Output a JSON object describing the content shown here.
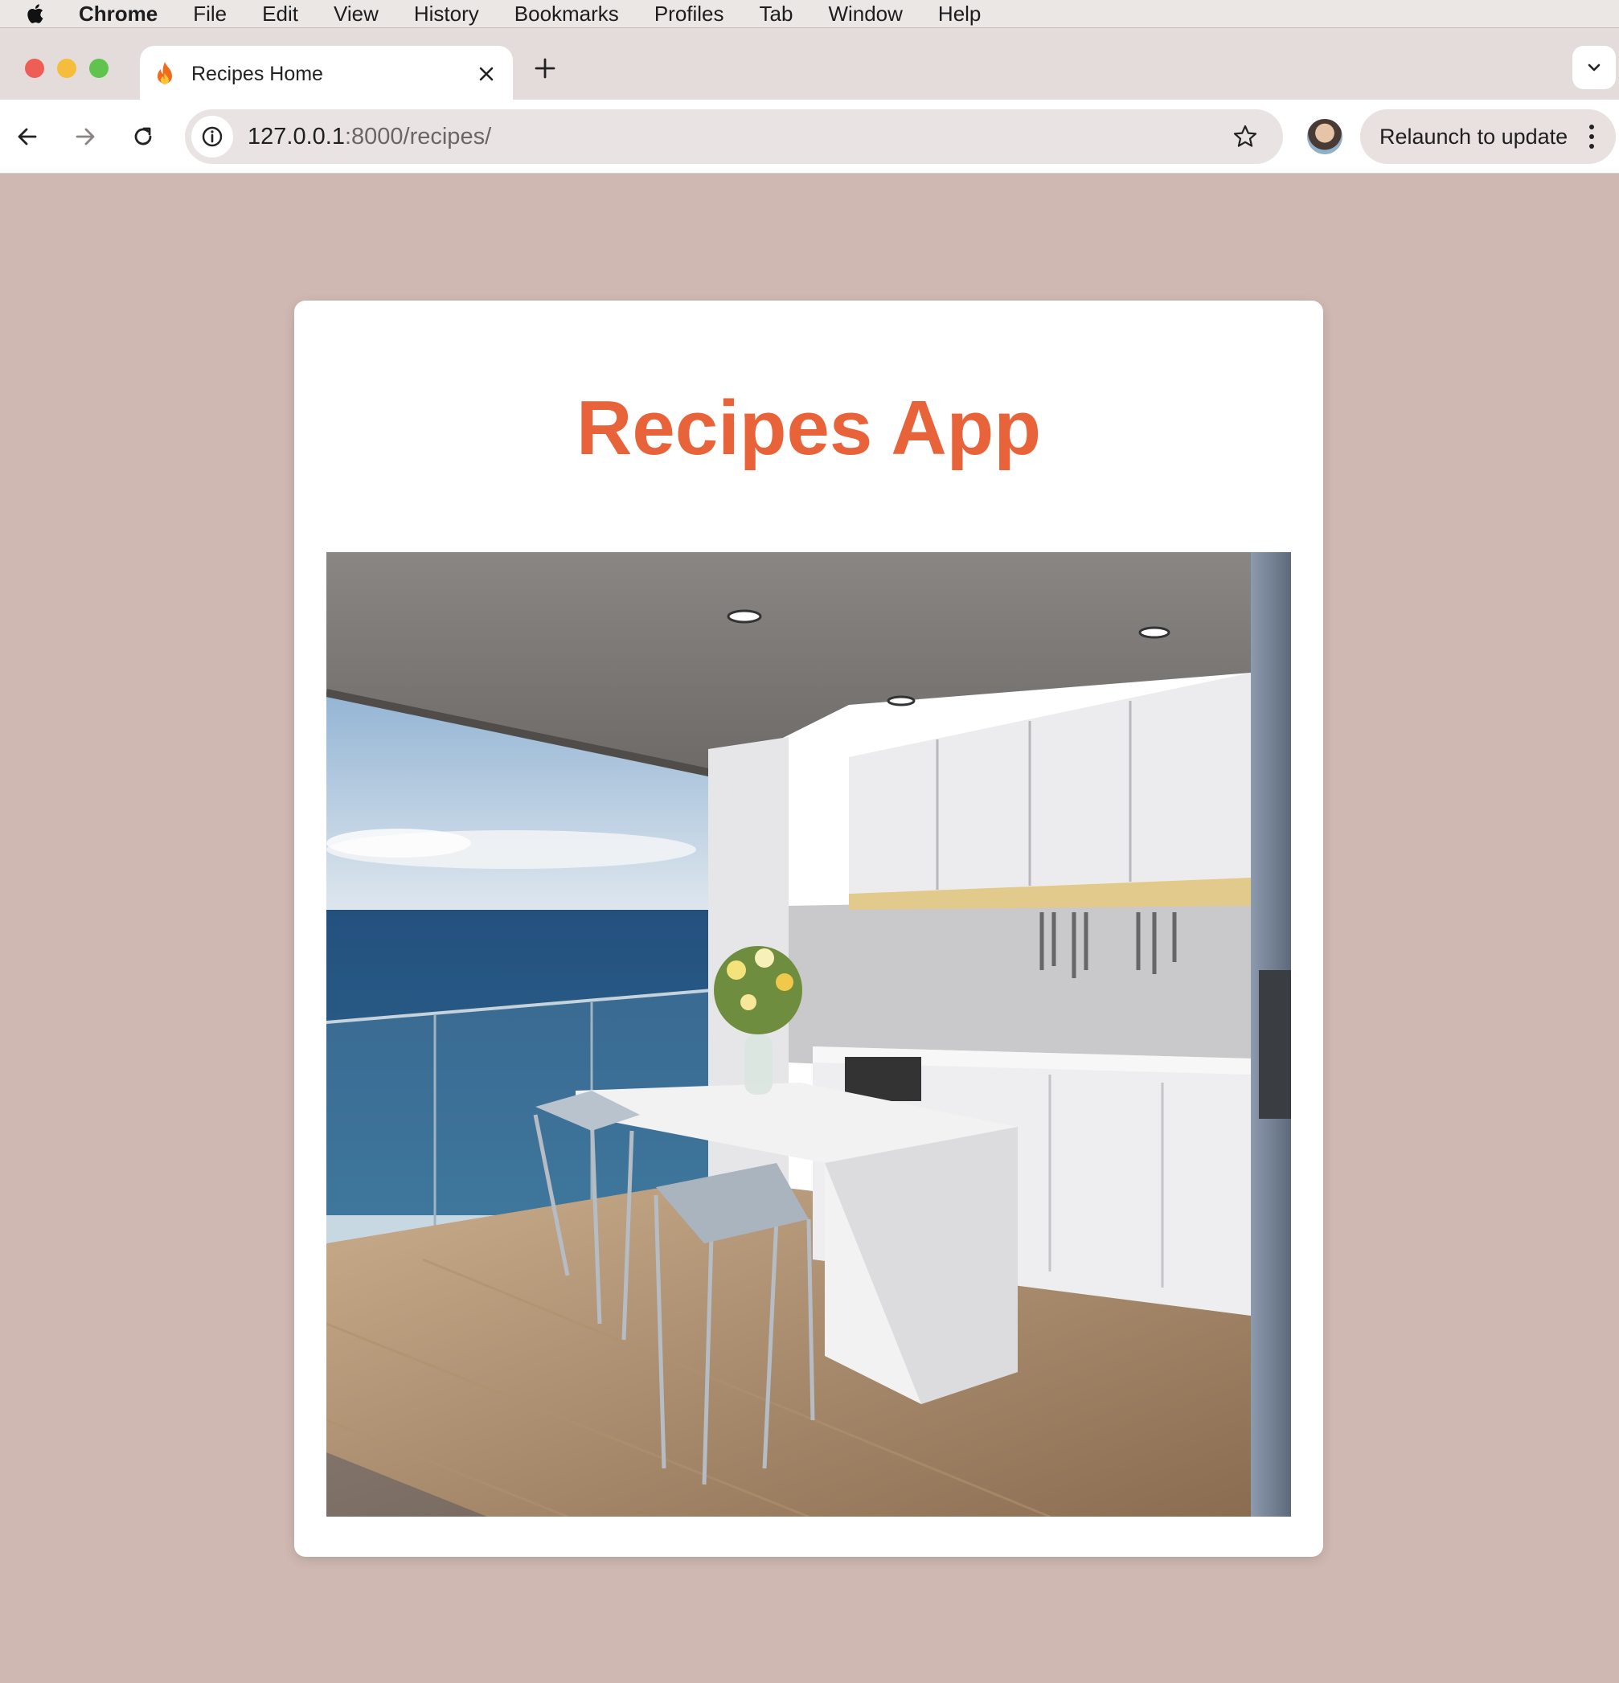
{
  "menubar": {
    "app": "Chrome",
    "items": [
      "File",
      "Edit",
      "View",
      "History",
      "Bookmarks",
      "Profiles",
      "Tab",
      "Window",
      "Help"
    ]
  },
  "tab": {
    "title": "Recipes Home",
    "favicon": "fire-icon"
  },
  "toolbar": {
    "url_host": "127.0.0.1",
    "url_path": ":8000/recipes/",
    "relaunch_label": "Relaunch to update"
  },
  "page": {
    "heading": "Recipes App",
    "heading_color": "#e8633a",
    "background_color": "#cfb8b1",
    "hero_image": "modern white kitchen with bar stools and balcony overlooking the sea"
  }
}
